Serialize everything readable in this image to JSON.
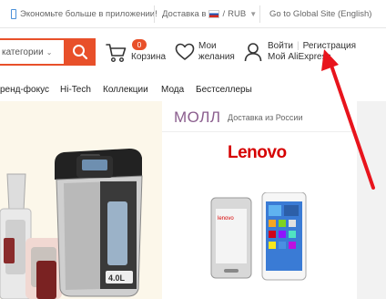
{
  "topbar": {
    "app_promo": "Экономьте больше в приложении!",
    "delivery_label": "Доставка в",
    "currency_sep": "/",
    "currency": "RUB",
    "global_site": "Go to Global Site (English)"
  },
  "header": {
    "category_select": "категории",
    "cart": {
      "count": "0",
      "label": "Корзина"
    },
    "wishlist": {
      "line1": "Мои",
      "line2": "желания"
    },
    "account": {
      "login": "Войти",
      "register": "Регистрация",
      "my_ali": "Мой AliExpress"
    }
  },
  "nav": {
    "items": [
      "ренд-фокус",
      "Hi-Tech",
      "Коллекции",
      "Мода",
      "Бестселлеры"
    ]
  },
  "mall": {
    "title": "МОЛЛ",
    "subtitle": "Доставка из России",
    "brand": "Lenovo"
  },
  "promo": {
    "capacity_label": "4.0L"
  },
  "colors": {
    "accent": "#e8502a",
    "mall_title": "#8b5e8e",
    "lenovo_red": "#d60000",
    "annotation_arrow": "#e8141c"
  },
  "icons": [
    "phone-icon",
    "russia-flag-icon",
    "search-icon",
    "cart-icon",
    "heart-icon",
    "user-icon",
    "annotation-arrow"
  ]
}
